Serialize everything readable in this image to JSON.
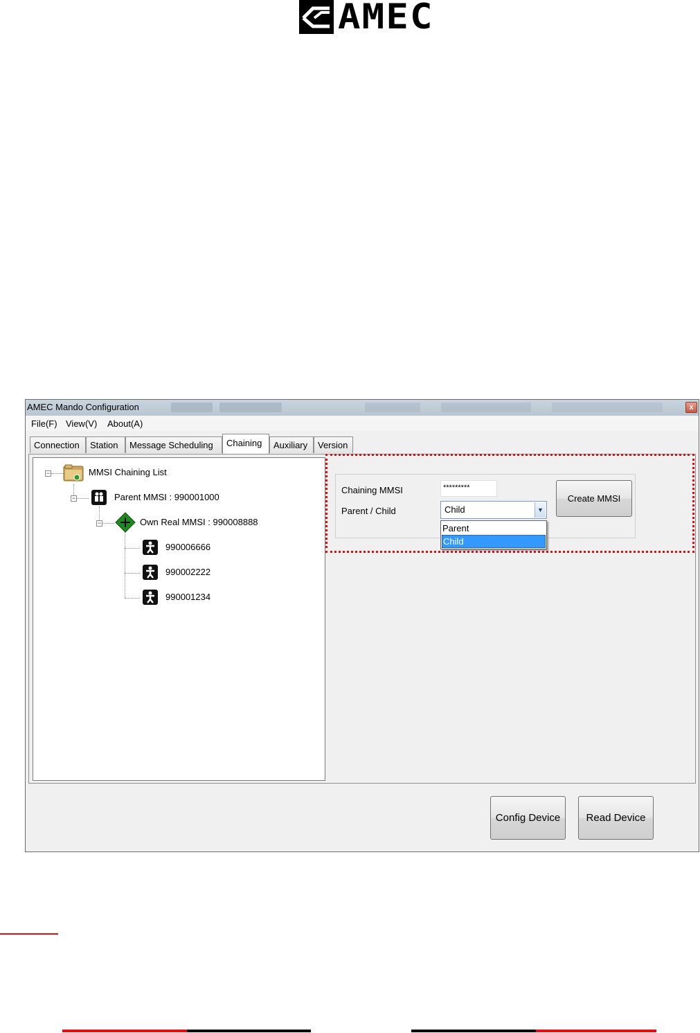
{
  "logo": {
    "text": "AMEC"
  },
  "window": {
    "title": "AMEC Mando Configuration",
    "close_glyph": "x",
    "menu": [
      "File(F)",
      "View(V)",
      "About(A)"
    ],
    "tabs": [
      "Connection",
      "Station",
      "Message Scheduling",
      "Chaining",
      "Auxiliary",
      "Version"
    ],
    "active_tab": "Chaining"
  },
  "tree": {
    "root": "MMSI Chaining List",
    "parent": "Parent MMSI : 990001000",
    "own": "Own Real MMSI : 990008888",
    "children": [
      "990006666",
      "990002222",
      "990001234"
    ],
    "expander_glyph": "−"
  },
  "form": {
    "chaining_label": "Chaining MMSI",
    "chaining_value": "*********",
    "parent_child_label": "Parent / Child",
    "selected": "Child",
    "options": [
      "Parent",
      "Child"
    ],
    "create_button": "Create MMSI",
    "arrow_glyph": "▼"
  },
  "footer": {
    "config_button": "Config Device",
    "read_button": "Read Device"
  },
  "colors": {
    "highlight": "#e01010",
    "selection": "#3399ff",
    "own_marker": "#1e8a1e"
  }
}
